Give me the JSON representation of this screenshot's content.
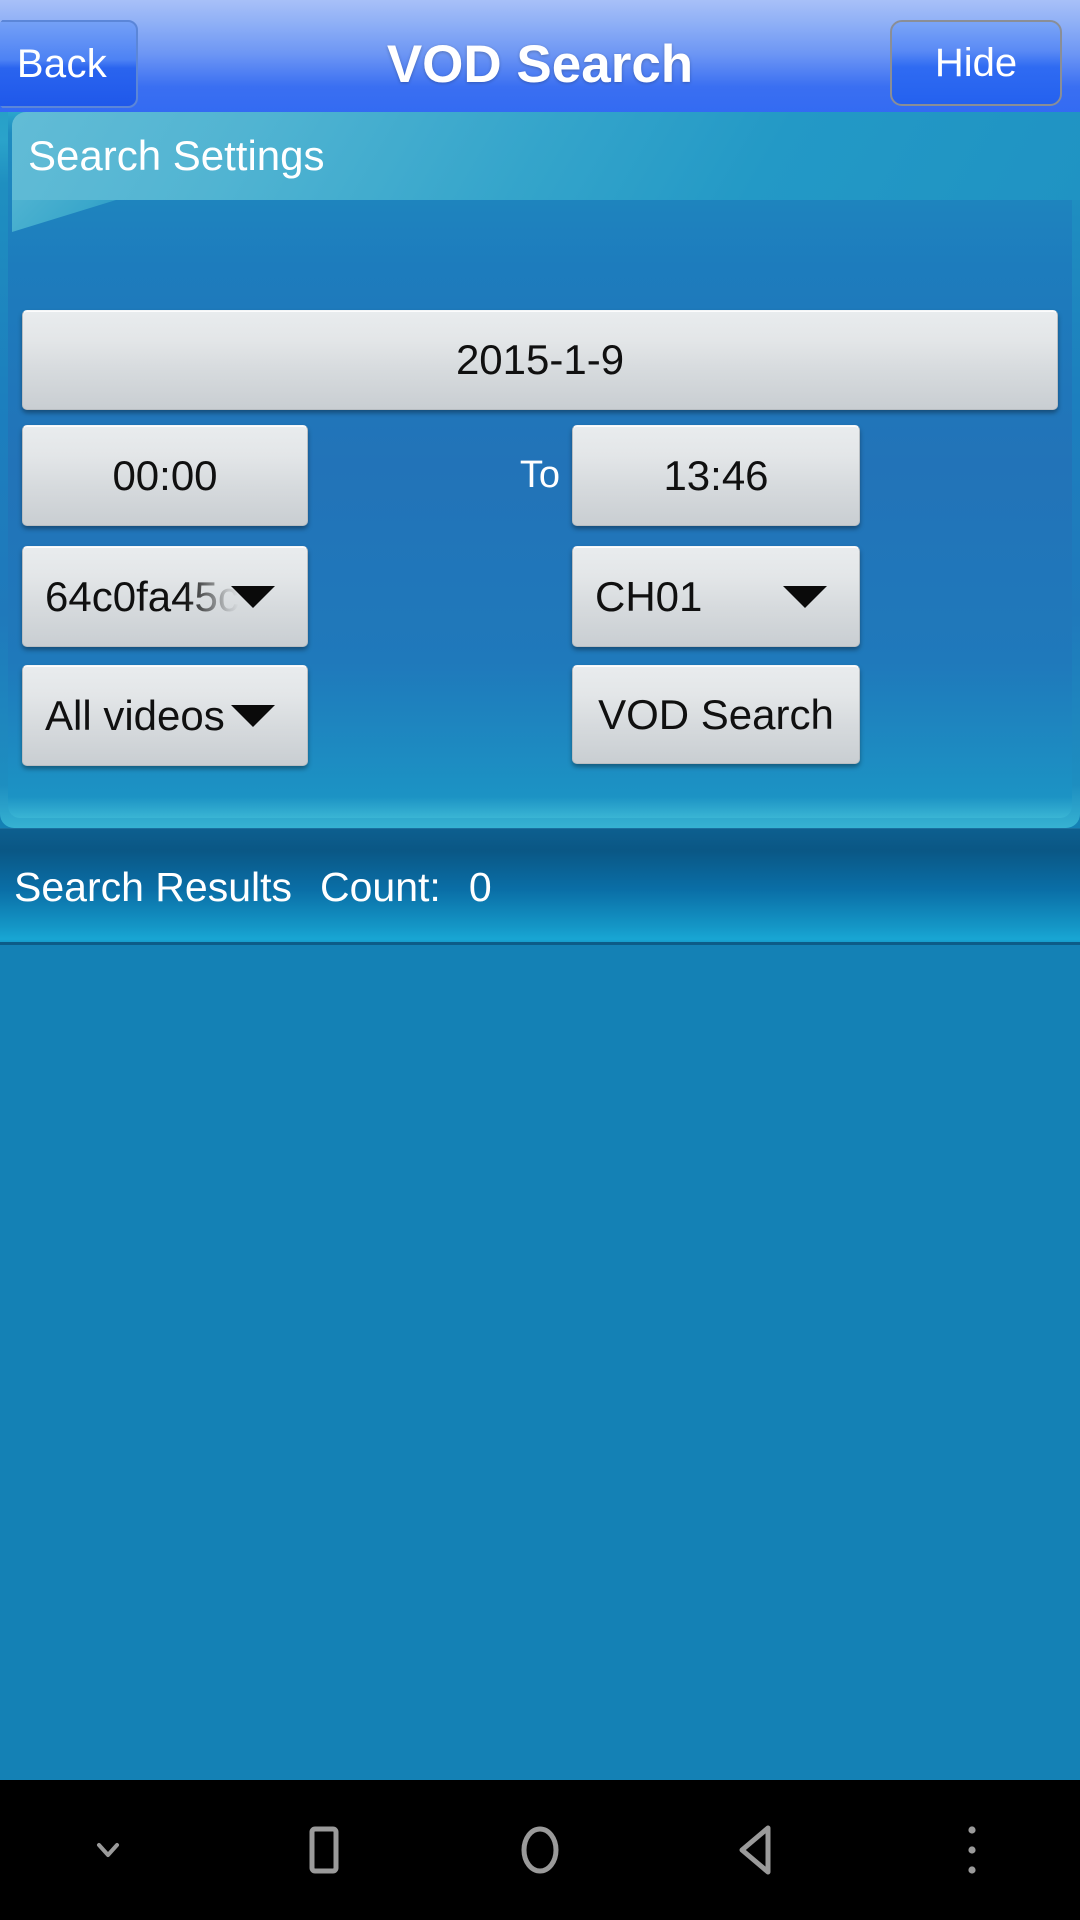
{
  "titlebar": {
    "back_label": "Back",
    "title": "VOD Search",
    "hide_label": "Hide"
  },
  "settings": {
    "header_label": "Search Settings",
    "date_value": "2015-1-9",
    "time_from": "00:00",
    "to_label": "To",
    "time_to": "13:46",
    "device_value": "64c0fa45c",
    "channel_value": "CH01",
    "video_type_value": "All videos",
    "search_button_label": "VOD Search"
  },
  "results": {
    "title": "Search Results",
    "count_label": "Count:",
    "count_value": "0",
    "rows": []
  },
  "navbar": {
    "items": [
      {
        "icon": "chevron-down-icon"
      },
      {
        "icon": "recents-square-icon"
      },
      {
        "icon": "home-circle-icon"
      },
      {
        "icon": "back-triangle-icon"
      },
      {
        "icon": "overflow-menu-icon"
      }
    ]
  },
  "colors": {
    "titlebar_blue": "#2f68f3",
    "panel_blue": "#1f79bb",
    "panel_teal": "#27a0c8",
    "content_blue": "#1481b5",
    "results_bar_dark": "#0a5785",
    "control_grey": "#dadfe2",
    "navbar_black": "#000000"
  }
}
